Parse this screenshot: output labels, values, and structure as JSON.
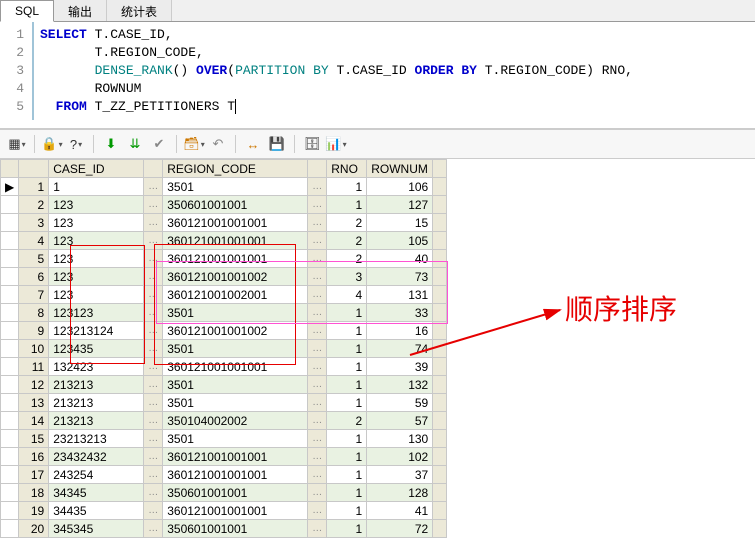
{
  "tabs": [
    {
      "label": "SQL",
      "active": true
    },
    {
      "label": "输出",
      "active": false
    },
    {
      "label": "统计表",
      "active": false
    }
  ],
  "sql": {
    "line1_kw": "SELECT",
    "line1_rest": " T.CASE_ID,",
    "line2": "       T.REGION_CODE,",
    "line3_a": "       ",
    "line3_fn": "DENSE_RANK",
    "line3_b": "() ",
    "line3_over": "OVER",
    "line3_c": "(",
    "line3_part": "PARTITION BY",
    "line3_d": " T.CASE_ID ",
    "line3_ord": "ORDER BY",
    "line3_e": " T.REGION_CODE) RNO,",
    "line4": "       ROWNUM",
    "line5_kw": "  FROM",
    "line5_rest": " T_ZZ_PETITIONERS T"
  },
  "line_numbers": [
    "1",
    "2",
    "3",
    "4",
    "5"
  ],
  "columns": [
    "CASE_ID",
    "REGION_CODE",
    "RNO",
    "ROWNUM"
  ],
  "rows": [
    {
      "n": 1,
      "case_id": "1",
      "region": "3501",
      "rno": 1,
      "rownum": 106
    },
    {
      "n": 2,
      "case_id": "123",
      "region": "350601001001",
      "rno": 1,
      "rownum": 127
    },
    {
      "n": 3,
      "case_id": "123",
      "region": "360121001001001",
      "rno": 2,
      "rownum": 15
    },
    {
      "n": 4,
      "case_id": "123",
      "region": "360121001001001",
      "rno": 2,
      "rownum": 105
    },
    {
      "n": 5,
      "case_id": "123",
      "region": "360121001001001",
      "rno": 2,
      "rownum": 40
    },
    {
      "n": 6,
      "case_id": "123",
      "region": "360121001001002",
      "rno": 3,
      "rownum": 73
    },
    {
      "n": 7,
      "case_id": "123",
      "region": "360121001002001",
      "rno": 4,
      "rownum": 131
    },
    {
      "n": 8,
      "case_id": "123123",
      "region": "3501",
      "rno": 1,
      "rownum": 33
    },
    {
      "n": 9,
      "case_id": "123213124",
      "region": "360121001001002",
      "rno": 1,
      "rownum": 16
    },
    {
      "n": 10,
      "case_id": "123435",
      "region": "3501",
      "rno": 1,
      "rownum": 74
    },
    {
      "n": 11,
      "case_id": "132423",
      "region": "360121001001001",
      "rno": 1,
      "rownum": 39
    },
    {
      "n": 12,
      "case_id": "213213",
      "region": "3501",
      "rno": 1,
      "rownum": 132
    },
    {
      "n": 13,
      "case_id": "213213",
      "region": "3501",
      "rno": 1,
      "rownum": 59
    },
    {
      "n": 14,
      "case_id": "213213",
      "region": "350104002002",
      "rno": 2,
      "rownum": 57
    },
    {
      "n": 15,
      "case_id": "23213213",
      "region": "3501",
      "rno": 1,
      "rownum": 130
    },
    {
      "n": 16,
      "case_id": "23432432",
      "region": "360121001001001",
      "rno": 1,
      "rownum": 102
    },
    {
      "n": 17,
      "case_id": "243254",
      "region": "360121001001001",
      "rno": 1,
      "rownum": 37
    },
    {
      "n": 18,
      "case_id": "34345",
      "region": "350601001001",
      "rno": 1,
      "rownum": 128
    },
    {
      "n": 19,
      "case_id": "34435",
      "region": "360121001001001",
      "rno": 1,
      "rownum": 41
    },
    {
      "n": 20,
      "case_id": "345345",
      "region": "350601001001",
      "rno": 1,
      "rownum": 72
    }
  ],
  "annotation": {
    "label": "顺序排序"
  },
  "toolbar_icons": [
    "grid",
    "lock",
    "help",
    "down1",
    "down2",
    "check",
    "bucket",
    "undo",
    "refresh",
    "save",
    "filter",
    "chart"
  ]
}
